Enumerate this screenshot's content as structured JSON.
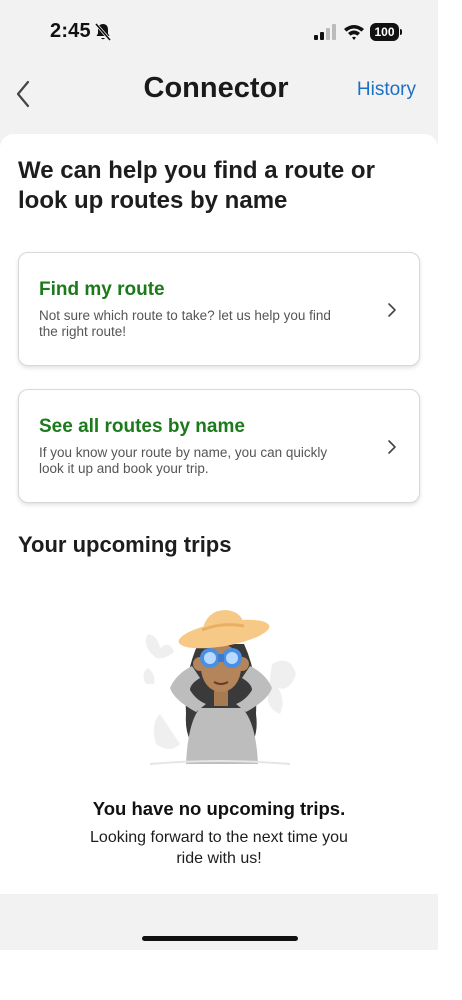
{
  "status_bar": {
    "time": "2:45",
    "battery": "100",
    "icons": [
      "bell-slash-icon",
      "signal-icon",
      "wifi-icon",
      "battery-icon"
    ]
  },
  "nav": {
    "back_icon": "chevron-left-icon",
    "title": "Connector",
    "history_label": "History"
  },
  "main": {
    "headline": "We can help you find a route or look up routes by name",
    "options": [
      {
        "title": "Find my route",
        "description": "Not sure which route to take? let us help you find the right route!",
        "icon": "chevron-right-icon"
      },
      {
        "title": "See all routes by name",
        "description": "If you know your route by name, you can quickly look it up and book your trip.",
        "icon": "chevron-right-icon"
      }
    ],
    "upcoming": {
      "section_title": "Your upcoming trips",
      "illustration": "woman-with-binoculars-illustration",
      "empty_title": "You have no upcoming trips.",
      "empty_subtitle": "Looking forward to the next time you ride with us!"
    }
  },
  "colors": {
    "accent_link": "#1e6fc4",
    "option_title": "#1b7a1b",
    "background": "#f2f2f2",
    "card": "#ffffff"
  }
}
